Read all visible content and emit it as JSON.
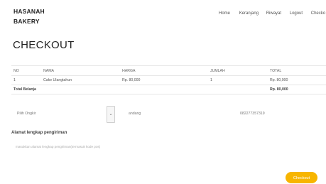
{
  "brand": {
    "line1": "HASANAH",
    "line2": "BAKERY"
  },
  "nav": {
    "items": [
      "Home",
      "Keranjang",
      "Riwayat",
      "Logout",
      "Checko"
    ]
  },
  "page": {
    "title": "CHECKOUT"
  },
  "table": {
    "headers": [
      "NO",
      "NAMA",
      "HARGA",
      "JUMLAH",
      "TOTAL"
    ],
    "rows": [
      {
        "no": "1",
        "nama": "Cake Ulangtahun",
        "harga": "Rp. 80,000",
        "jumlah": "1",
        "total": "Rp. 80,000"
      }
    ],
    "total_label": "Total Belanja",
    "total_value": "Rp. 80,000"
  },
  "form": {
    "ongkir_placeholder": "Pilih Ongkir",
    "arrow_icon": "chevron-down-icon",
    "name_value": "andang",
    "phone_value": "082277357319",
    "address_label": "Alamat lengkap pengiriman",
    "address_placeholder": "masukkan alamat lengkap pengiriman(termasuk kode pos)"
  },
  "actions": {
    "checkout_label": "Checkout"
  },
  "colors": {
    "accent": "#f7b500"
  }
}
